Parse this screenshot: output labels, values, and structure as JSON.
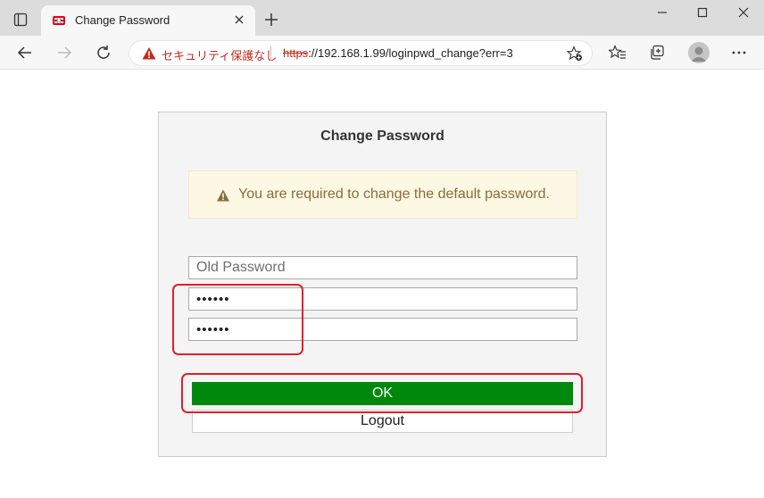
{
  "browser": {
    "tab_title": "Change Password",
    "omnibox": {
      "security_label": "セキュリティ保護なし",
      "url_scheme": "https",
      "url_rest": "://192.168.1.99/loginpwd_change?err=3"
    }
  },
  "page": {
    "title": "Change Password",
    "alert_message": "You are required to change the default password.",
    "fields": {
      "old_password_placeholder": "Old Password",
      "new_password_value": "123456",
      "confirm_password_value": "123456"
    },
    "ok_label": "OK",
    "logout_label": "Logout"
  },
  "colors": {
    "ok_button": "#00880d",
    "alert_bg": "#fcf8e3",
    "alert_text": "#8a6d3b",
    "not_secure": "#c42b1c",
    "highlight": "#e0202a"
  }
}
